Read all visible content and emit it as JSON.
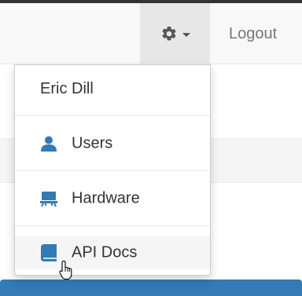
{
  "navbar": {
    "settings_icon": "gear-icon",
    "caret_icon": "caret-down-icon",
    "logout_label": "Logout"
  },
  "dropdown": {
    "header": "Eric Dill",
    "items": [
      {
        "label": "Users",
        "icon": "user-icon"
      },
      {
        "label": "Hardware",
        "icon": "hardware-icon"
      },
      {
        "label": "API Docs",
        "icon": "book-icon"
      }
    ]
  },
  "colors": {
    "accent": "#337ab7",
    "navbar_bg": "#f8f8f8",
    "active_toggle_bg": "#e7e7e7"
  }
}
